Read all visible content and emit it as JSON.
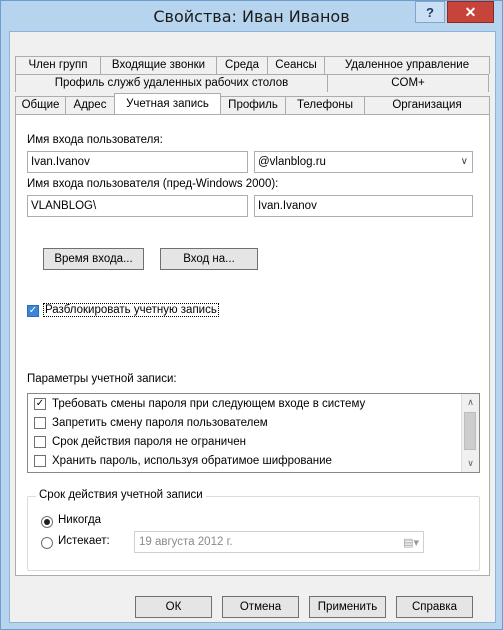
{
  "window": {
    "title": "Свойства: Иван Иванов",
    "help_label": "?",
    "close_label": "✕"
  },
  "tabs": {
    "row1": [
      "Член групп",
      "Входящие звонки",
      "Среда",
      "Сеансы",
      "Удаленное управление"
    ],
    "row2": [
      "Профиль служб удаленных рабочих столов",
      "COM+"
    ],
    "row3": [
      "Общие",
      "Адрес",
      "Учетная запись",
      "Профиль",
      "Телефоны",
      "Организация"
    ],
    "active": "Учетная запись"
  },
  "account": {
    "logon_name_label": "Имя входа пользователя:",
    "logon_name_value": "Ivan.Ivanov",
    "domain_suffix": "@vlanblog.ru",
    "pre2000_label": "Имя входа пользователя (пред-Windows 2000):",
    "pre2000_domain": "VLANBLOG\\",
    "pre2000_name": "Ivan.Ivanov",
    "logon_hours_button": "Время входа...",
    "logon_to_button": "Вход на...",
    "unlock_label": "Разблокировать учетную запись",
    "unlock_checked": true,
    "options_label": "Параметры учетной записи:",
    "options": [
      {
        "label": "Требовать смены пароля при следующем входе в систему",
        "checked": true
      },
      {
        "label": "Запретить смену пароля пользователем",
        "checked": false
      },
      {
        "label": "Срок действия пароля не ограничен",
        "checked": false
      },
      {
        "label": "Хранить пароль, используя обратимое шифрование",
        "checked": false
      }
    ]
  },
  "expiry": {
    "group_title": "Срок действия учетной записи",
    "never_label": "Никогда",
    "expires_label": "Истекает:",
    "selected": "never",
    "date_value": "19  августа  2012 г."
  },
  "footer": {
    "ok": "ОК",
    "cancel": "Отмена",
    "apply": "Применить",
    "help": "Справка"
  }
}
